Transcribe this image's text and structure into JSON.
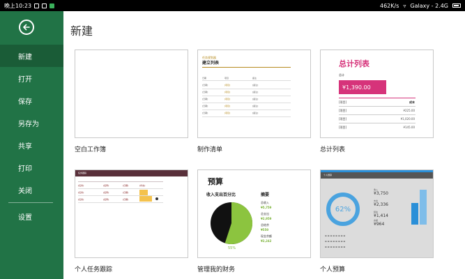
{
  "statusbar": {
    "time": "晚上10:23",
    "speed": "462K/s",
    "wifi": "Galaxy - 2.4G"
  },
  "sidebar": {
    "items": [
      {
        "label": "新建"
      },
      {
        "label": "打开"
      },
      {
        "label": "保存"
      },
      {
        "label": "另存为"
      },
      {
        "label": "共享"
      },
      {
        "label": "打印"
      },
      {
        "label": "关闭"
      },
      {
        "label": "设置"
      }
    ]
  },
  "main": {
    "title": "新建",
    "templates": [
      {
        "label": "空白工作簿"
      },
      {
        "label": "制作清单"
      },
      {
        "label": "总计列表"
      },
      {
        "label": "个人任务跟踪"
      },
      {
        "label": "管理我的财务"
      },
      {
        "label": "个人预算"
      }
    ]
  },
  "thumb_checklist": {
    "category": "任务规划器",
    "title": "建立列表",
    "headers": [
      "日期",
      "项目",
      "备注"
    ],
    "rows": [
      [
        "[日期]",
        "[项目]",
        "[备注]"
      ],
      [
        "[日期]",
        "[项目]",
        "[备注]"
      ],
      [
        "[日期]",
        "[项目]",
        "[备注]"
      ],
      [
        "[日期]",
        "[项目]",
        "[备注]"
      ],
      [
        "[日期]",
        "[项目]",
        "[备注]"
      ]
    ]
  },
  "thumb_total": {
    "title": "总计列表",
    "subtitle": "总计",
    "total": "¥1,390.00",
    "col_item": "[项目]",
    "col_cost": "成本",
    "rows": [
      {
        "label": "[项目]",
        "value": "¥225.00"
      },
      {
        "label": "[项目]",
        "value": "¥1,020.00"
      },
      {
        "label": "[项目]",
        "value": "¥145.00"
      }
    ]
  },
  "thumb_tracker": {
    "title": "任务跟踪",
    "rows": [
      {
        "c1": "[任务]",
        "c2": "[名称]",
        "c3": "[日期]",
        "c4": "[状态]"
      },
      {
        "c1": "[任务]",
        "c2": "[名称]",
        "c3": "[日期]",
        "c4": "[状态]"
      },
      {
        "c1": "[任务]",
        "c2": "[名称]",
        "c3": "[日期]",
        "c4": "[状态]"
      }
    ]
  },
  "thumb_finance": {
    "title": "预算",
    "pie_title": "收入支出百分比",
    "summary_title": "摘要",
    "items": [
      {
        "label": "总收入",
        "value": "¥5,759"
      },
      {
        "label": "总支出",
        "value": "¥2,959"
      },
      {
        "label": "总结余",
        "value": "¥550"
      },
      {
        "label": "现金余额",
        "value": "¥2,242"
      }
    ],
    "percent": "55%",
    "colors": {
      "primary": "#8cc43f",
      "dark": "#111111"
    }
  },
  "thumb_budget": {
    "title": "个人预算",
    "percent": "62%",
    "figures": [
      {
        "label": "收入",
        "value": "¥3,750"
      },
      {
        "label": "支出",
        "value": "¥2,336"
      },
      {
        "label": "结余",
        "value": "¥1,414"
      },
      {
        "label": "余额",
        "value": "¥964"
      }
    ],
    "bars": [
      0.55,
      0.9
    ]
  }
}
